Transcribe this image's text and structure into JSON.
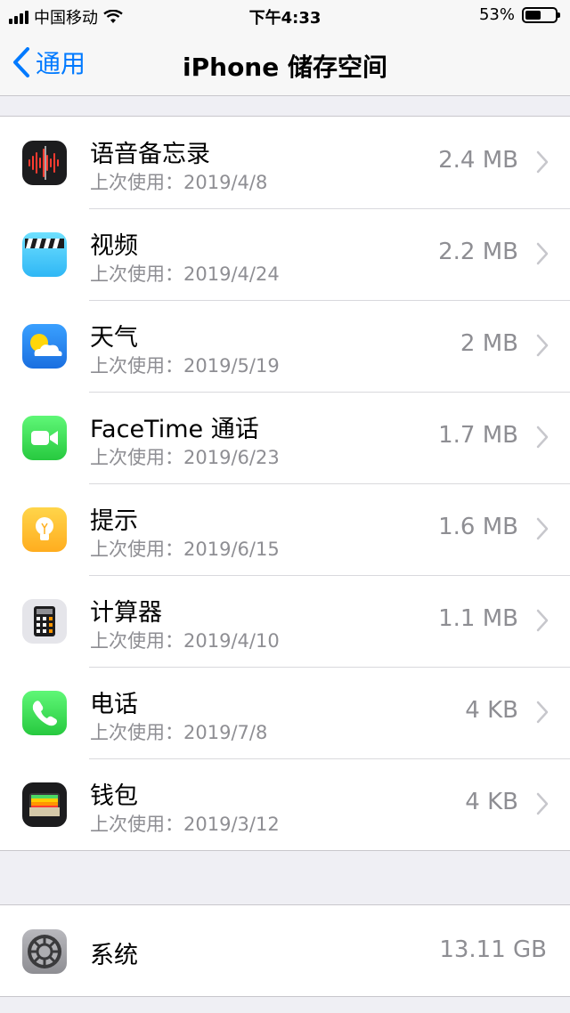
{
  "status_bar": {
    "carrier": "中国移动",
    "time": "下午4:33",
    "battery": "53%",
    "battery_level": 0.53
  },
  "nav": {
    "back_label": "通用",
    "title": "iPhone 储存空间"
  },
  "apps": [
    {
      "name": "语音备忘录",
      "date_label": "上次使用：",
      "date": "2019/4/8",
      "size": "2.4 MB",
      "icon": "voice-memos-icon"
    },
    {
      "name": "视频",
      "date_label": "上次使用：",
      "date": "2019/4/24",
      "size": "2.2 MB",
      "icon": "videos-icon"
    },
    {
      "name": "天气",
      "date_label": "上次使用：",
      "date": "2019/5/19",
      "size": "2 MB",
      "icon": "weather-icon"
    },
    {
      "name": "FaceTime 通话",
      "date_label": "上次使用：",
      "date": "2019/6/23",
      "size": "1.7 MB",
      "icon": "facetime-icon"
    },
    {
      "name": "提示",
      "date_label": "上次使用：",
      "date": "2019/6/15",
      "size": "1.6 MB",
      "icon": "tips-icon"
    },
    {
      "name": "计算器",
      "date_label": "上次使用：",
      "date": "2019/4/10",
      "size": "1.1 MB",
      "icon": "calculator-icon"
    },
    {
      "name": "电话",
      "date_label": "上次使用：",
      "date": "2019/7/8",
      "size": "4 KB",
      "icon": "phone-icon"
    },
    {
      "name": "钱包",
      "date_label": "上次使用：",
      "date": "2019/3/12",
      "size": "4 KB",
      "icon": "wallet-icon"
    }
  ],
  "system": {
    "name": "系统",
    "size": "13.11 GB",
    "icon": "settings-gear-icon"
  },
  "colors": {
    "accent": "#007aff",
    "secondary_text": "#8e8e93",
    "background": "#efeff4"
  }
}
